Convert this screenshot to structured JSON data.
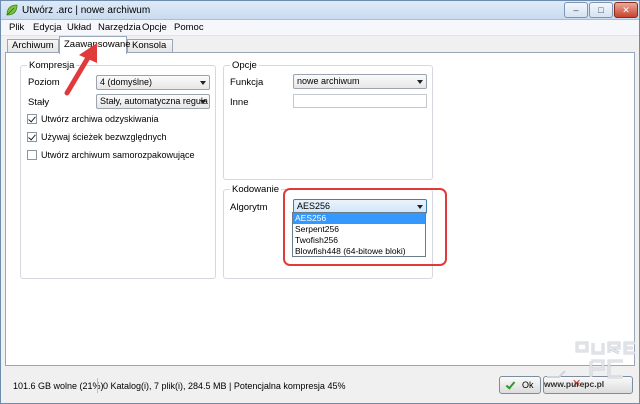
{
  "window": {
    "title": "Utwórz .arc | nowe archiwum",
    "buttons": {
      "minimize": "–",
      "maximize": "□",
      "close": "✕"
    }
  },
  "menu": [
    "Plik",
    "Edycja",
    "Układ",
    "Narzędzia",
    "Opcje",
    "Pomoc"
  ],
  "tabs": [
    "Archiwum",
    "Zaawansowane",
    "Konsola"
  ],
  "active_tab": "Zaawansowane",
  "compression": {
    "title": "Kompresja",
    "level_label": "Poziom",
    "level_value": "4 (domyślne)",
    "solid_label": "Stały",
    "solid_value": "Stały, automatyczna reguła",
    "checkboxes": [
      {
        "label": "Utwórz archiwa odzyskiwania",
        "checked": true
      },
      {
        "label": "Używaj ścieżek bezwzględnych",
        "checked": true
      },
      {
        "label": "Utwórz archiwum samorozpakowujące",
        "checked": false
      }
    ]
  },
  "options": {
    "title": "Opcje",
    "function_label": "Funkcja",
    "function_value": "nowe archiwum",
    "other_label": "Inne",
    "other_value": ""
  },
  "encoding": {
    "title": "Kodowanie",
    "algorithm_label": "Algorytm",
    "algorithm_value": "AES256",
    "options": [
      "AES256",
      "Serpent256",
      "Twofish256",
      "Blowfish448 (64-bitowe bloki)"
    ],
    "selected_index": 0
  },
  "status": {
    "free_space": "101.6 GB wolne (21%)",
    "summary": "0 Katalog(i), 7 plik(i), 284.5 MB | Potencjalna kompresja 45%",
    "ok_label": "Ok"
  },
  "watermark": {
    "url": "www.purepc.pl"
  },
  "colors": {
    "annotation": "#e03a3a",
    "selection": "#3399ff",
    "accent": "#6e8cad"
  }
}
